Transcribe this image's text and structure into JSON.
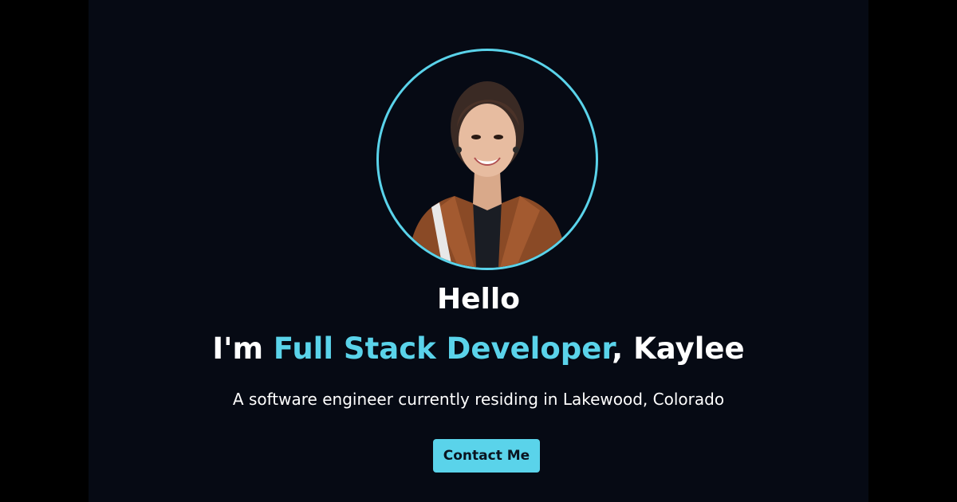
{
  "hero": {
    "greeting": "Hello",
    "headline_prefix": "I'm ",
    "headline_role": "Full Stack Developer",
    "headline_suffix": ", Kaylee",
    "subtitle": "A software engineer currently residing in Lakewood, Colorado",
    "contact_label": "Contact Me",
    "avatar_icon": "profile-photo"
  },
  "colors": {
    "accent": "#5ad3ea",
    "background": "#060a14",
    "outer_background": "#000000",
    "text": "#ffffff"
  }
}
